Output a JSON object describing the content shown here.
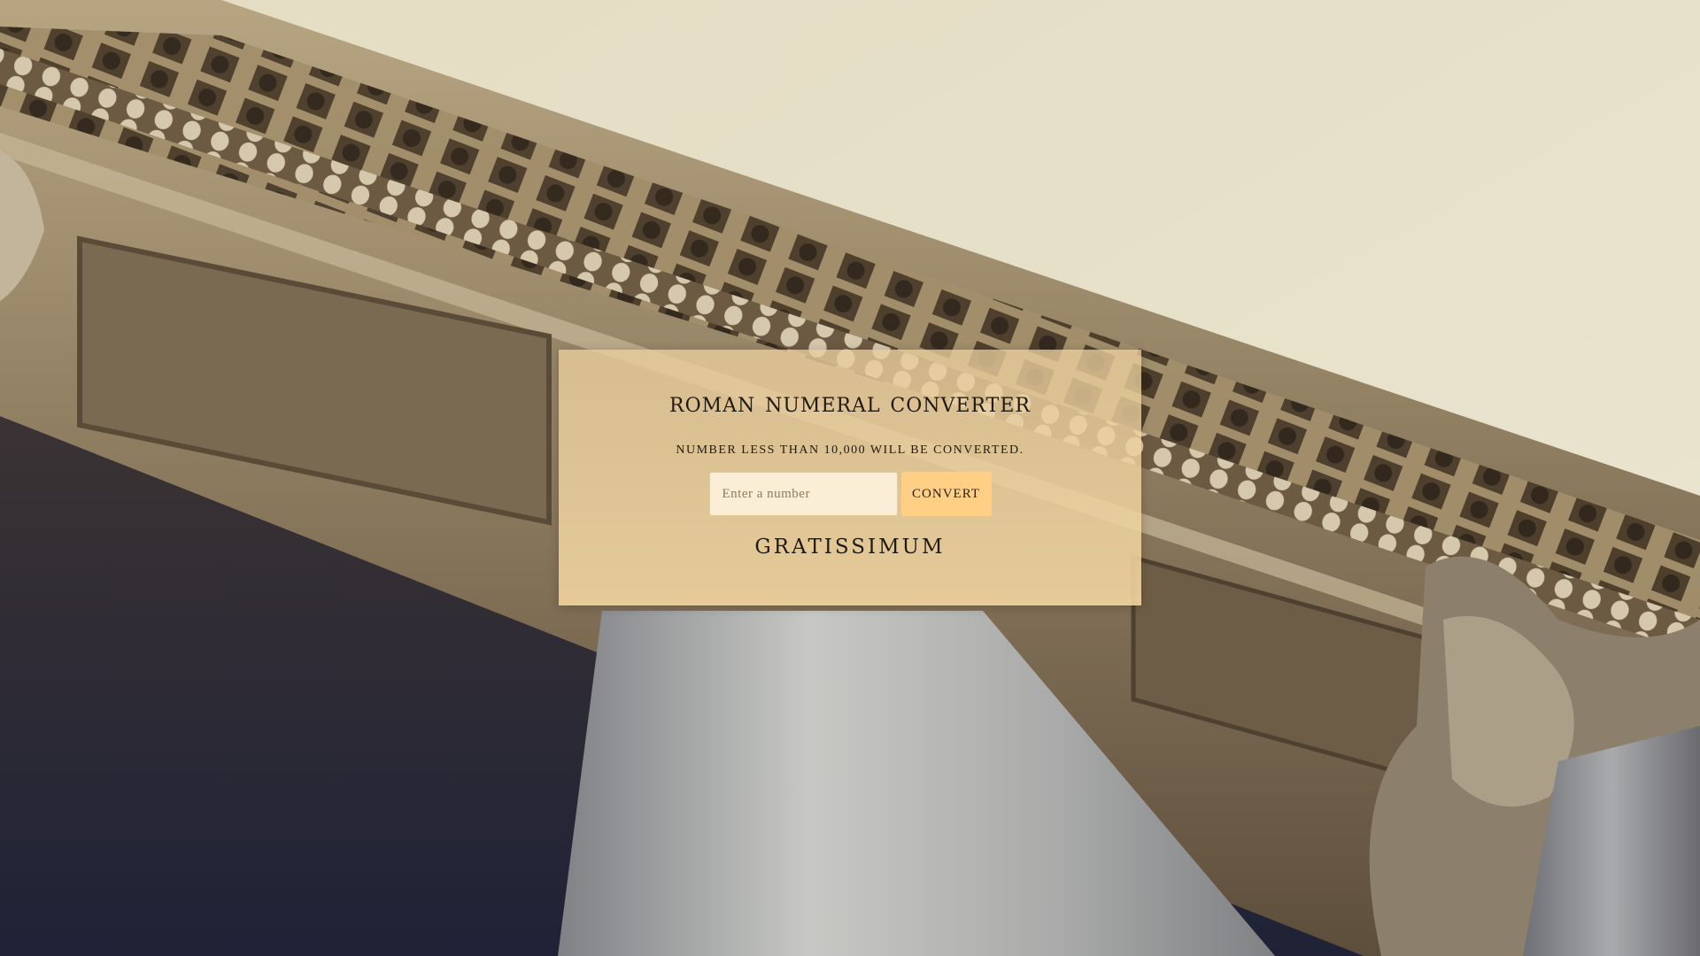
{
  "converter": {
    "title": "ROMAN NUMERAL CONVERTER",
    "subtitle": "NUMBER LESS THAN 10,000 WILL BE CONVERTED.",
    "input_placeholder": "Enter a number",
    "input_value": "",
    "convert_label": "CONVERT",
    "result": "GRATISSIMUM"
  },
  "colors": {
    "sky": "#e7e0c6",
    "card": "#eccf9c",
    "button": "#ffcf86",
    "input": "#fbeed6",
    "text": "#1f1a12"
  }
}
